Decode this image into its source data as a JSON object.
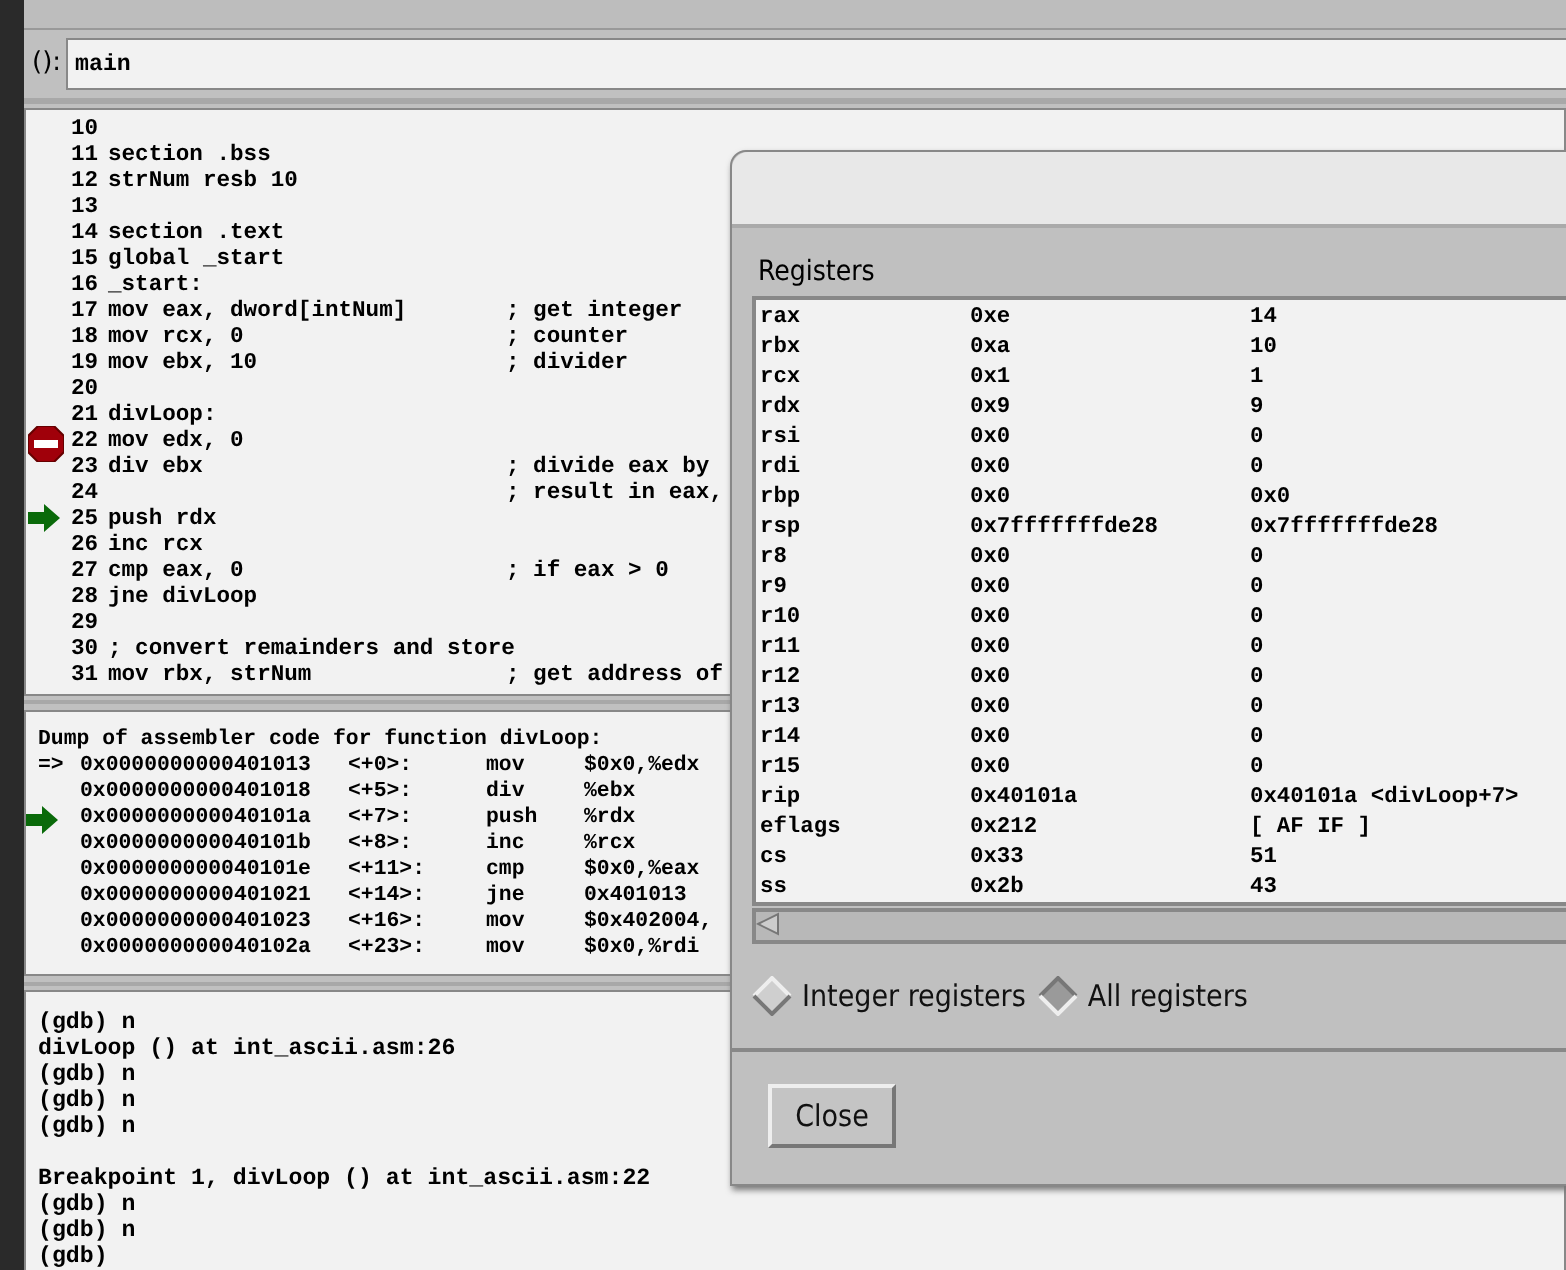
{
  "argument_bar": {
    "label": "():",
    "value": "main"
  },
  "source": {
    "lines": [
      {
        "number": "10",
        "breakpoint": false,
        "current": false
      },
      {
        "number": "11",
        "code": "section .bss",
        "breakpoint": false,
        "current": false
      },
      {
        "number": "12",
        "code": "strNum resb 10",
        "breakpoint": false,
        "current": false
      },
      {
        "number": "13",
        "breakpoint": false,
        "current": false
      },
      {
        "number": "14",
        "code": "section .text",
        "breakpoint": false,
        "current": false
      },
      {
        "number": "15",
        "code": "global _start",
        "breakpoint": false,
        "current": false
      },
      {
        "number": "16",
        "code": "_start:",
        "breakpoint": false,
        "current": false
      },
      {
        "number": "17",
        "code": "mov eax, dword[intNum]",
        "comment": "; get integer",
        "breakpoint": false,
        "current": false
      },
      {
        "number": "18",
        "code": "mov rcx, 0",
        "comment": "; counter",
        "breakpoint": false,
        "current": false
      },
      {
        "number": "19",
        "code": "mov ebx, 10",
        "comment": "; divider",
        "breakpoint": false,
        "current": false
      },
      {
        "number": "20",
        "breakpoint": false,
        "current": false
      },
      {
        "number": "21",
        "code": "divLoop:",
        "breakpoint": false,
        "current": false
      },
      {
        "number": "22",
        "code": "mov edx, 0",
        "breakpoint": true,
        "current": false
      },
      {
        "number": "23",
        "code": "div ebx",
        "comment": "; divide eax by",
        "breakpoint": false,
        "current": false
      },
      {
        "number": "24",
        "comment": "; result in eax,",
        "breakpoint": false,
        "current": false
      },
      {
        "number": "25",
        "code": "push rdx",
        "breakpoint": false,
        "current": true
      },
      {
        "number": "26",
        "code": "inc rcx",
        "breakpoint": false,
        "current": false
      },
      {
        "number": "27",
        "code": "cmp eax, 0",
        "comment": "; if eax > 0",
        "breakpoint": false,
        "current": false
      },
      {
        "number": "28",
        "code": "jne divLoop",
        "breakpoint": false,
        "current": false
      },
      {
        "number": "29",
        "breakpoint": false,
        "current": false
      },
      {
        "number": "30",
        "code": "; convert remainders and store",
        "breakpoint": false,
        "current": false
      },
      {
        "number": "31",
        "code": "mov rbx, strNum",
        "comment": "; get address of",
        "breakpoint": false,
        "current": false
      }
    ]
  },
  "machine_code": {
    "header": "Dump of assembler code for function divLoop:",
    "rows": [
      {
        "prefix": "=>",
        "current": false,
        "address": "0x0000000000401013",
        "offset": "<+0>:",
        "mnemonic": "mov",
        "operands": "$0x0,%edx"
      },
      {
        "current": false,
        "address": "0x0000000000401018",
        "offset": "<+5>:",
        "mnemonic": "div",
        "operands": "%ebx"
      },
      {
        "current": true,
        "address": "0x000000000040101a",
        "offset": "<+7>:",
        "mnemonic": "push",
        "operands": "%rdx"
      },
      {
        "current": false,
        "address": "0x000000000040101b",
        "offset": "<+8>:",
        "mnemonic": "inc",
        "operands": "%rcx"
      },
      {
        "current": false,
        "address": "0x000000000040101e",
        "offset": "<+11>:",
        "mnemonic": "cmp",
        "operands": "$0x0,%eax"
      },
      {
        "current": false,
        "address": "0x0000000000401021",
        "offset": "<+14>:",
        "mnemonic": "jne",
        "operands": "0x401013"
      },
      {
        "current": false,
        "address": "0x0000000000401023",
        "offset": "<+16>:",
        "mnemonic": "mov",
        "operands": "$0x402004,"
      },
      {
        "current": false,
        "address": "0x000000000040102a",
        "offset": "<+23>:",
        "mnemonic": "mov",
        "operands": "$0x0,%rdi"
      }
    ]
  },
  "console": {
    "blocks": [
      {
        "lines": [
          "(gdb) n",
          "divLoop () at int_ascii.asm:26",
          "(gdb) n",
          "(gdb) n",
          "(gdb) n"
        ]
      },
      {
        "lines": [
          "Breakpoint 1, divLoop () at int_ascii.asm:22",
          "(gdb) n",
          "(gdb) n",
          "(gdb)"
        ]
      }
    ]
  },
  "registers_dialog": {
    "title": "Registers",
    "rows": [
      {
        "name": "rax",
        "raw": "0xe",
        "natural": "14"
      },
      {
        "name": "rbx",
        "raw": "0xa",
        "natural": "10"
      },
      {
        "name": "rcx",
        "raw": "0x1",
        "natural": "1"
      },
      {
        "name": "rdx",
        "raw": "0x9",
        "natural": "9"
      },
      {
        "name": "rsi",
        "raw": "0x0",
        "natural": "0"
      },
      {
        "name": "rdi",
        "raw": "0x0",
        "natural": "0"
      },
      {
        "name": "rbp",
        "raw": "0x0",
        "natural": "0x0"
      },
      {
        "name": "rsp",
        "raw": "0x7fffffffde28",
        "natural": "0x7fffffffde28"
      },
      {
        "name": "r8",
        "raw": "0x0",
        "natural": "0"
      },
      {
        "name": "r9",
        "raw": "0x0",
        "natural": "0"
      },
      {
        "name": "r10",
        "raw": "0x0",
        "natural": "0"
      },
      {
        "name": "r11",
        "raw": "0x0",
        "natural": "0"
      },
      {
        "name": "r12",
        "raw": "0x0",
        "natural": "0"
      },
      {
        "name": "r13",
        "raw": "0x0",
        "natural": "0"
      },
      {
        "name": "r14",
        "raw": "0x0",
        "natural": "0"
      },
      {
        "name": "r15",
        "raw": "0x0",
        "natural": "0"
      },
      {
        "name": "rip",
        "raw": "0x40101a",
        "natural": "0x40101a <divLoop+7>"
      },
      {
        "name": "eflags",
        "raw": "0x212",
        "natural": "[ AF IF ]"
      },
      {
        "name": "cs",
        "raw": "0x33",
        "natural": "51"
      },
      {
        "name": "ss",
        "raw": "0x2b",
        "natural": "43"
      }
    ],
    "options": [
      {
        "label": "Integer registers",
        "selected": false
      },
      {
        "label": "All registers",
        "selected": true
      }
    ],
    "buttons": [
      "Close"
    ]
  }
}
